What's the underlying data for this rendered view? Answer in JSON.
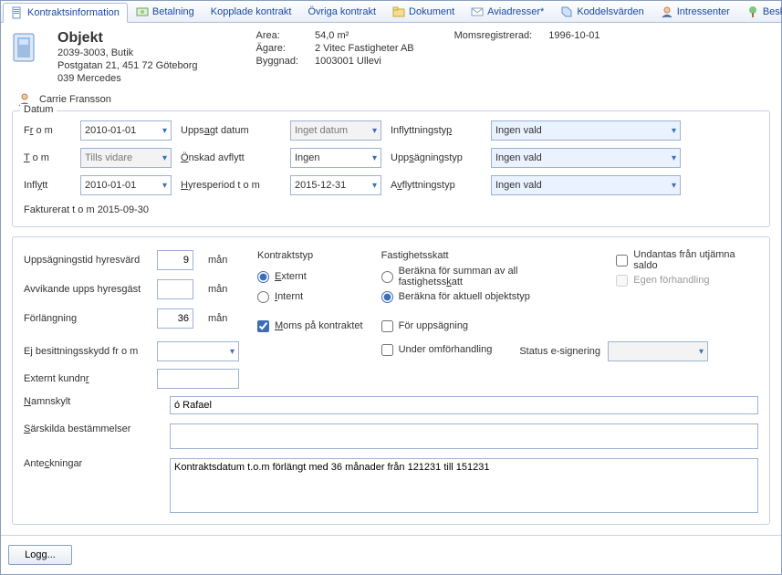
{
  "tabs": {
    "kontraktsinfo": "Kontraktsinformation",
    "betalning": "Betalning",
    "kopplade": "Kopplade kontrakt",
    "ovriga": "Övriga kontrakt",
    "dokument": "Dokument",
    "aviadresser": "Aviadresser*",
    "koddel": "Koddelsvärden",
    "intressenter": "Intressenter",
    "beskrivningar": "Beskrivningar"
  },
  "object": {
    "title": "Objekt",
    "code_line": "2039-3003,  Butik",
    "address": "Postgatan 21, 451 72 Göteborg",
    "extra": "039 Mercedes"
  },
  "meta": {
    "area_label": "Area:",
    "area_value": "54,0 m²",
    "agare_label": "Ägare:",
    "agare_value": "2 Vitec Fastigheter AB",
    "byggnad_label": "Byggnad:",
    "byggnad_value": "1003001 Ullevi",
    "momsreg_label": "Momsregistrerad:",
    "momsreg_value": "1996-10-01"
  },
  "person": {
    "name": "Carrie Fransson"
  },
  "datum": {
    "legend": "Datum",
    "from_label_pre": "F",
    "from_label_u": "r",
    "from_label_post": " o m",
    "from_value": "2010-01-01",
    "tom_label_u": "T",
    "tom_label_post": " o m",
    "tom_value": "Tills vidare",
    "inflytt_label_pre": "Infl",
    "inflytt_label_u": "y",
    "inflytt_label_post": "tt",
    "inflytt_value": "2010-01-01",
    "uppsagt_label_pre": "Upps",
    "uppsagt_label_u": "a",
    "uppsagt_label_post": "gt datum",
    "uppsagt_value": "Inget datum",
    "onskad_label_u": "Ö",
    "onskad_label_post": "nskad avflytt",
    "onskad_value": "Ingen",
    "hyresper_label_u": "H",
    "hyresper_label_post": "yresperiod t o m",
    "hyresper_value": "2015-12-31",
    "inflyttyp_label_pre": "Inflyttningsty",
    "inflyttyp_label_u": "p",
    "inflyttyp_value": "Ingen vald",
    "uppstyp_label_pre": "Upp",
    "uppstyp_label_u": "s",
    "uppstyp_label_post": "ägningstyp",
    "uppstyp_value": "Ingen vald",
    "avflyttyp_label_pre": "A",
    "avflyttyp_label_u": "v",
    "avflyttyp_label_post": "flyttningstyp",
    "avflyttyp_value": "Ingen vald",
    "fakturerat": "Fakturerat t o m 2015-09-30"
  },
  "settings": {
    "uppstid_label": "Uppsägningstid hyresvärd",
    "uppstid_value": "9",
    "man": "mån",
    "avvik_label": "Avvikande upps hyresgäst",
    "avvik_value": "",
    "forlangning_label": "Förlängning",
    "forlangning_value": "36",
    "ejbesitt_label_pre": "E",
    "ejbesitt_label_u": "j",
    "ejbesitt_label_post": " besittningsskydd fr o m",
    "extkund_label_pre": "Externt kundn",
    "extkund_label_u": "r",
    "kontraktstyp_title": "Kontraktstyp",
    "externt_label_u": "E",
    "externt_label_post": "xternt",
    "internt_label_u": "I",
    "internt_label_post": "nternt",
    "moms_label_u": "M",
    "moms_label_post": "oms på kontraktet",
    "fastighetsskatt_title": "Fastighetsskatt",
    "fsk_option1_pre": "Beräkna för summan av all fastighetss",
    "fsk_option1_u": "k",
    "fsk_option1_post": "att",
    "fsk_option2": "Beräkna för aktuell objektstyp",
    "undantas_label": "Undantas från utjämna saldo",
    "egen_label": "Egen förhandling",
    "for_upps_label": "För uppsägning",
    "under_omf_label": "Under omförhandling",
    "status_label": "Status e-signering"
  },
  "bottom": {
    "namskylt_label_u": "N",
    "namskylt_label_post": "amnskylt",
    "namskylt_value": "ó Rafael",
    "sarskilda_label_u": "S",
    "sarskilda_label_post": "ärskilda bestämmelser",
    "sarskilda_value": "",
    "anteckningar_label_pre": "Ante",
    "anteckningar_label_u": "c",
    "anteckningar_label_post": "kningar",
    "anteckningar_value": "Kontraktsdatum t.o.m förlängt med 36 månader från 121231 till 151231"
  },
  "footer": {
    "logg": "Logg..."
  }
}
